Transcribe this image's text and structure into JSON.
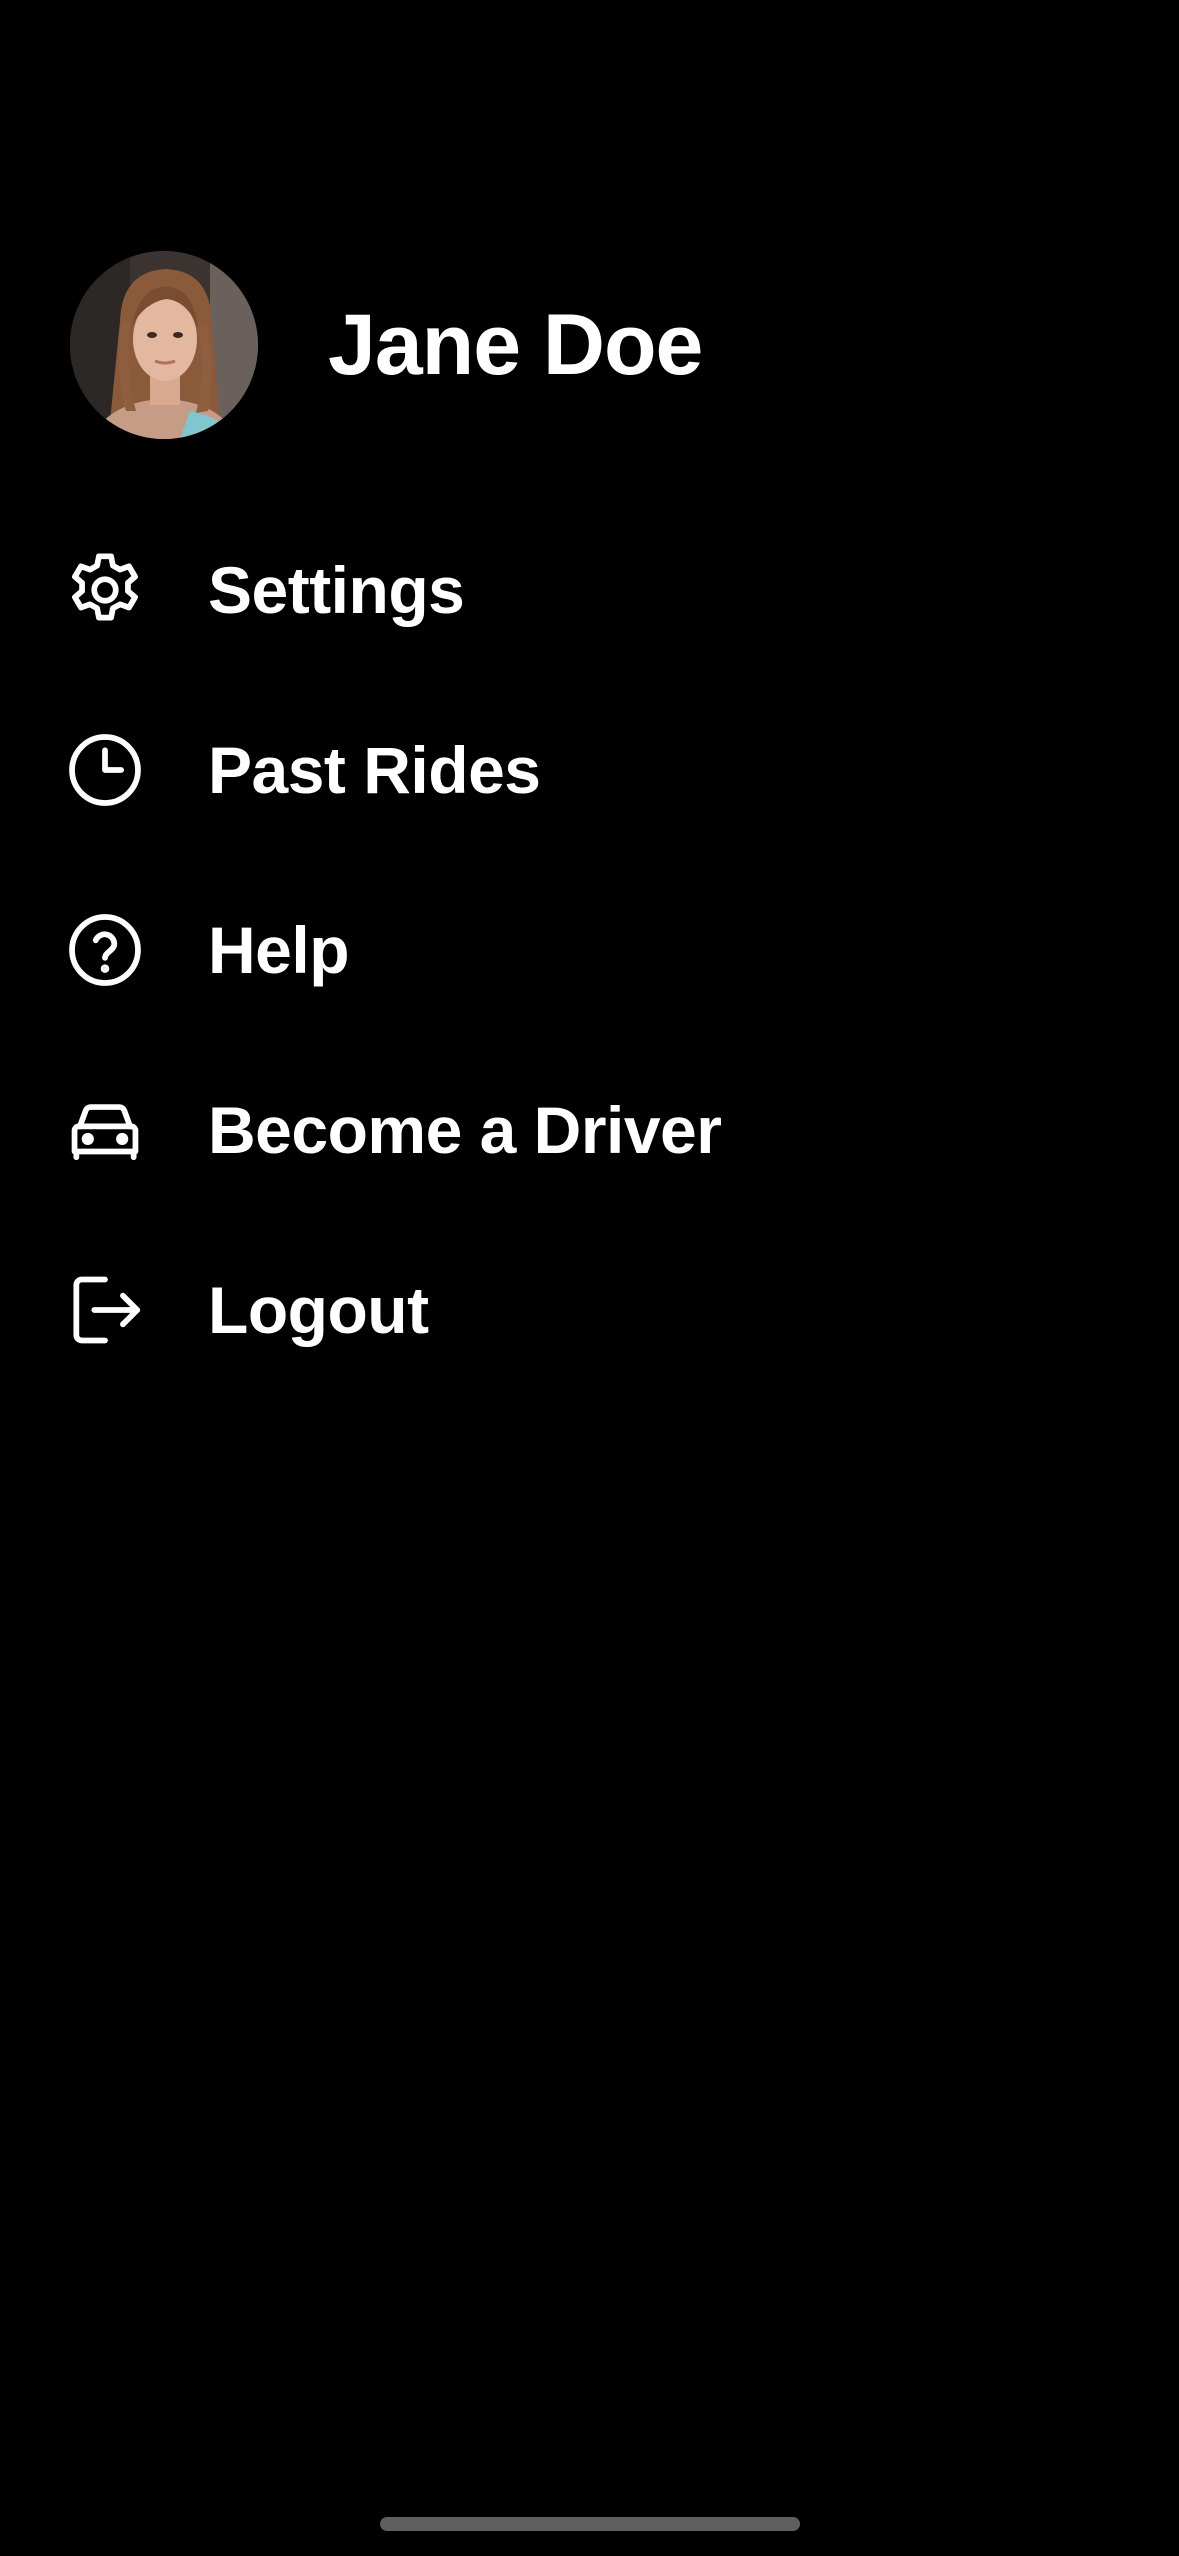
{
  "profile": {
    "name": "Jane Doe",
    "avatar_icon": "user-photo"
  },
  "menu": {
    "items": [
      {
        "label": "Settings",
        "icon": "gear-icon"
      },
      {
        "label": "Past Rides",
        "icon": "clock-icon"
      },
      {
        "label": "Help",
        "icon": "question-circle-icon"
      },
      {
        "label": "Become a Driver",
        "icon": "car-icon"
      },
      {
        "label": "Logout",
        "icon": "logout-icon"
      }
    ]
  },
  "colors": {
    "background": "#000000",
    "text": "#ffffff",
    "home_indicator": "#5e5e5e"
  }
}
